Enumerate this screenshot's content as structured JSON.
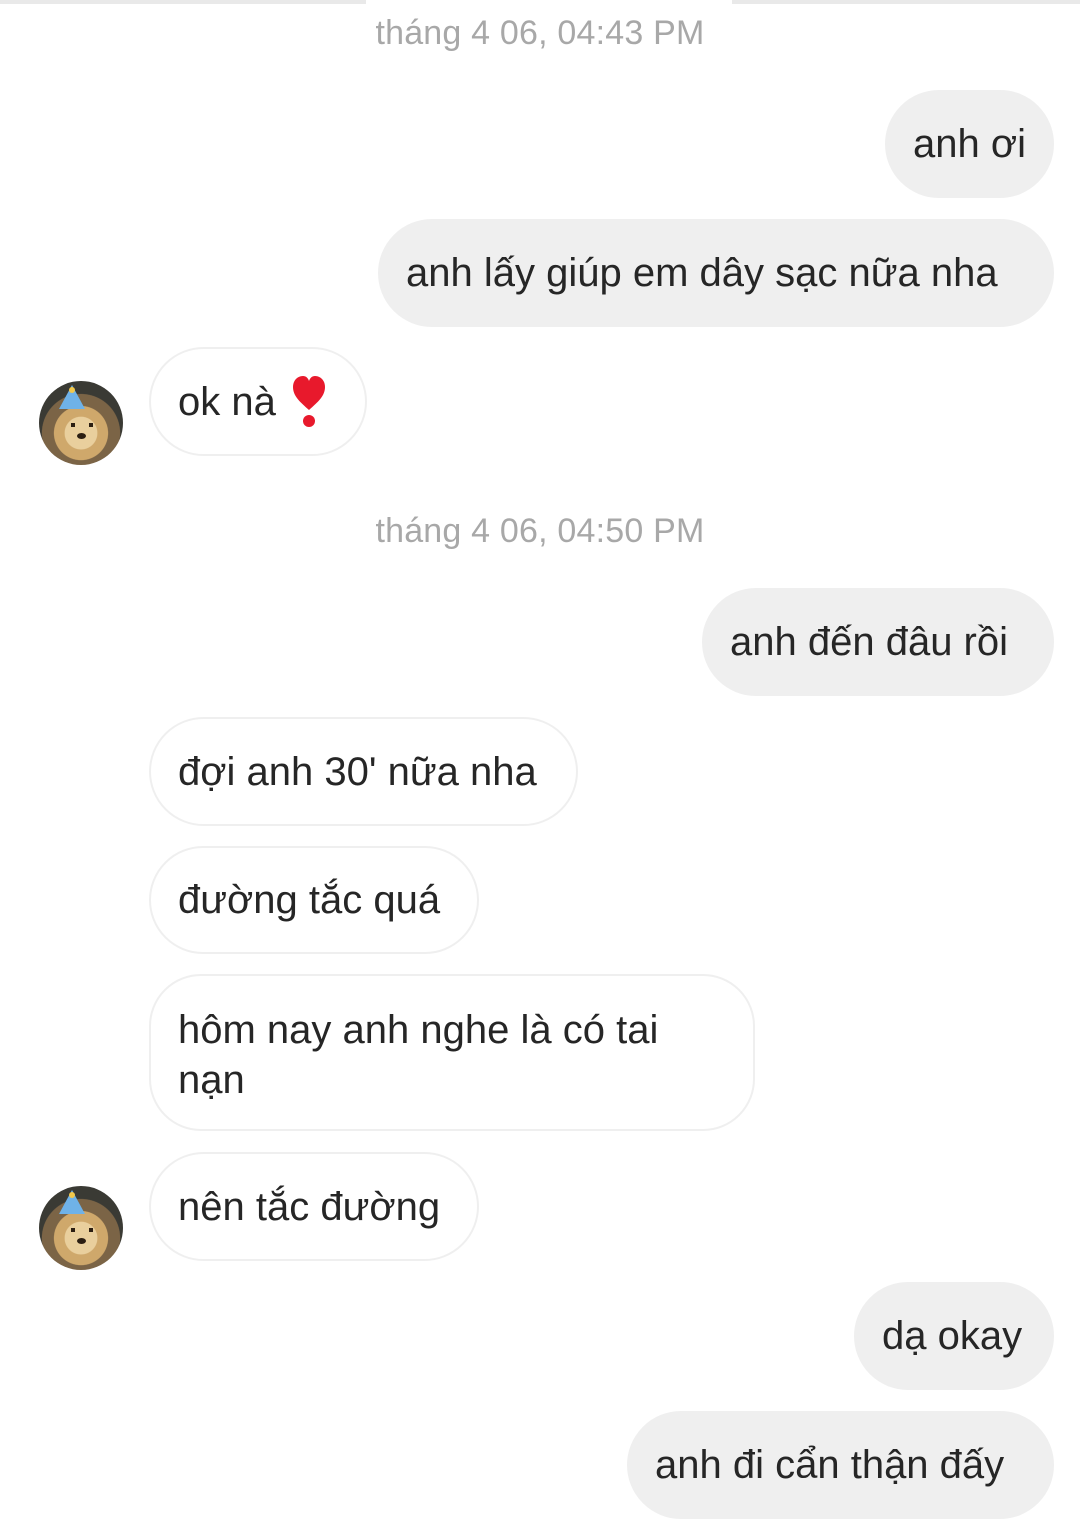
{
  "timestamps": [
    "tháng 4 06, 04:43 PM",
    "tháng 4 06, 04:50 PM"
  ],
  "messages": [
    {
      "sender": "me",
      "text": "anh ơi"
    },
    {
      "sender": "me",
      "text": "anh lấy giúp em dây sạc nữa nha"
    },
    {
      "sender": "other",
      "text": "ok nà",
      "icon": "heavy-exclamation-heart-icon"
    },
    {
      "sender": "me",
      "text": "anh đến đâu rồi"
    },
    {
      "sender": "other",
      "text": "đợi anh 30' nữa nha"
    },
    {
      "sender": "other",
      "text": "đường tắc quá"
    },
    {
      "sender": "other",
      "text": "hôm nay anh nghe là có tai nạn"
    },
    {
      "sender": "other",
      "text": "nên tắc đường"
    },
    {
      "sender": "me",
      "text": "dạ okay"
    },
    {
      "sender": "me",
      "text": "anh đi cẩn thận đấy"
    }
  ],
  "colors": {
    "sent_bubble": "#efefef",
    "received_border": "#efefef",
    "text": "#262626",
    "timestamp": "#a8a8a8",
    "heart": "#e8192c"
  },
  "avatar": {
    "icon": "puppy-party-hat-avatar"
  }
}
